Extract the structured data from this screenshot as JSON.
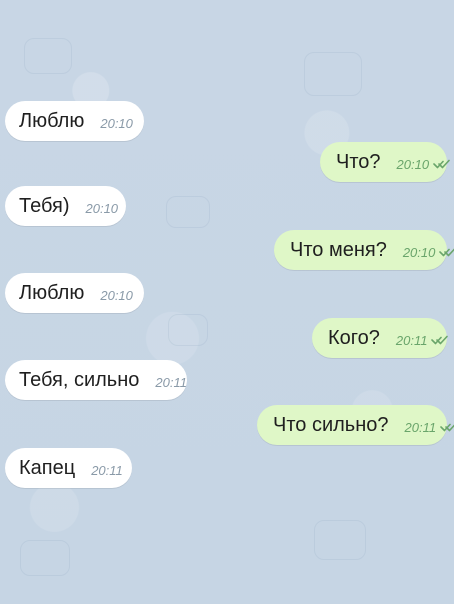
{
  "messages": [
    {
      "text": "Люблю",
      "time": "20:10",
      "side": "incoming"
    },
    {
      "text": "Что?",
      "time": "20:10",
      "side": "outgoing"
    },
    {
      "text": "Тебя)",
      "time": "20:10",
      "side": "incoming"
    },
    {
      "text": "Что меня?",
      "time": "20:10",
      "side": "outgoing"
    },
    {
      "text": "Люблю",
      "time": "20:10",
      "side": "incoming"
    },
    {
      "text": "Кого?",
      "time": "20:11",
      "side": "outgoing"
    },
    {
      "text": "Тебя, сильно",
      "time": "20:11",
      "side": "incoming"
    },
    {
      "text": "Что сильно?",
      "time": "20:11",
      "side": "outgoing"
    },
    {
      "text": "Капец",
      "time": "20:11",
      "side": "incoming"
    }
  ],
  "icons": {
    "read_status": "double-check-icon"
  },
  "colors": {
    "background": "#c9d7e6",
    "incoming_bubble": "#ffffff",
    "outgoing_bubble": "#dff7c7",
    "text": "#1f1f1f",
    "incoming_time": "#8a9aa8",
    "outgoing_time": "#6aa56b"
  }
}
